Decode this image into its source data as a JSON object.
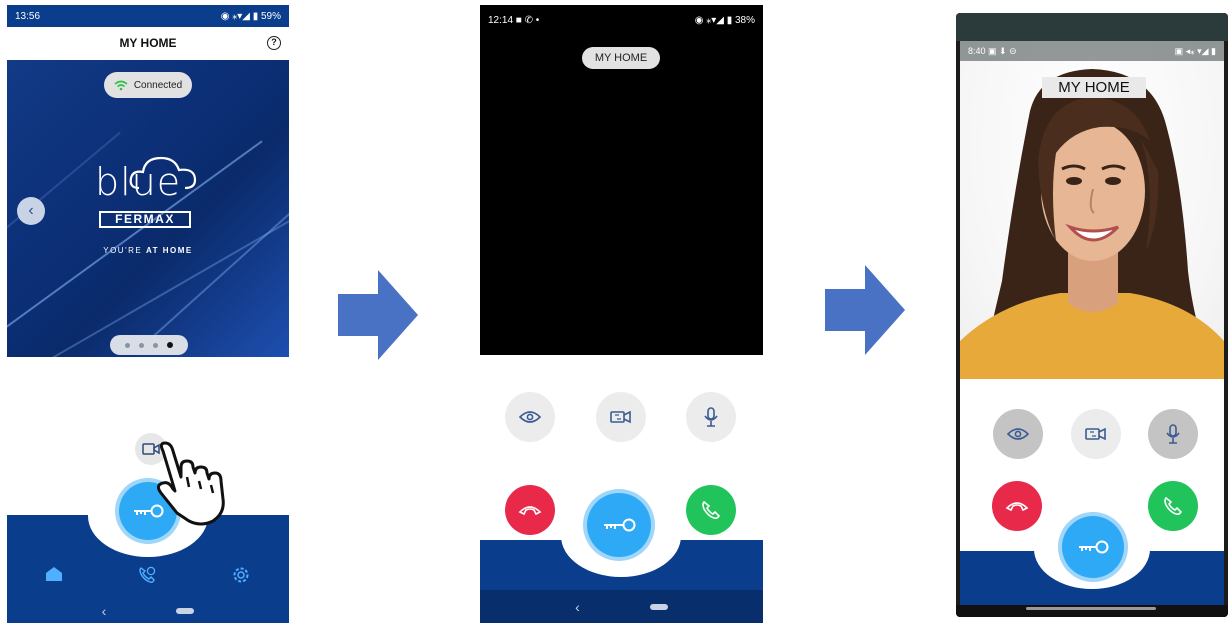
{
  "screen1": {
    "status_time": "13:56",
    "status_battery": "59%",
    "title": "MY HOME",
    "connection_label": "Connected",
    "brand_top": "blue",
    "brand_bottom": "FERMAX",
    "tagline_pre": "YOU'RE",
    "tagline_bold": "AT HOME",
    "carousel_total": 4,
    "carousel_active": 4
  },
  "screen2": {
    "status_time": "12:14",
    "status_battery": "38%",
    "title": "MY HOME"
  },
  "screen3": {
    "status_time": "8:40",
    "title": "MY HOME"
  },
  "colors": {
    "brand_blue": "#0a3d8c",
    "key_blue": "#2ea9f5",
    "hangup_red": "#e8294a",
    "answer_green": "#21c45a",
    "arrow_blue": "#4a72c4"
  }
}
